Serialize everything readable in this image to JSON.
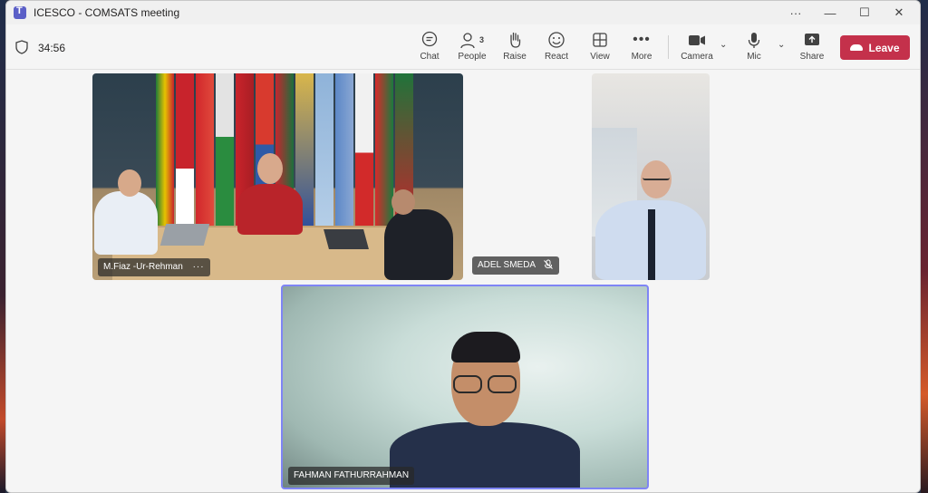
{
  "window": {
    "title": "ICESCO - COMSATS meeting",
    "controls": [
      "···",
      "—",
      "☐",
      "✕"
    ]
  },
  "meeting": {
    "duration": "34:56"
  },
  "toolbar": {
    "chat": {
      "label": "Chat",
      "icon": "chat-icon"
    },
    "people": {
      "label": "People",
      "icon": "people-icon",
      "count": "3"
    },
    "raise": {
      "label": "Raise",
      "icon": "raise-hand-icon"
    },
    "react": {
      "label": "React",
      "icon": "react-icon"
    },
    "view": {
      "label": "View",
      "icon": "view-icon"
    },
    "more": {
      "label": "More",
      "icon": "more-icon"
    },
    "camera": {
      "label": "Camera",
      "icon": "camera-icon"
    },
    "mic": {
      "label": "Mic",
      "icon": "mic-icon"
    },
    "share": {
      "label": "Share",
      "icon": "share-icon"
    },
    "leave": {
      "label": "Leave",
      "color": "#c4314b"
    }
  },
  "participants": [
    {
      "name": "M.Fiaz -Ur-Rehman",
      "menu": "···"
    },
    {
      "name": "ADEL SMEDA",
      "muted": true
    },
    {
      "name": "",
      "note": "unlabeled video tile"
    },
    {
      "name": "FAHMAN FATHURRAHMAN",
      "active_speaker": true
    }
  ],
  "colors": {
    "accent": "#7f85f5",
    "leave": "#c4314b",
    "brand": "#5b5fc7"
  }
}
